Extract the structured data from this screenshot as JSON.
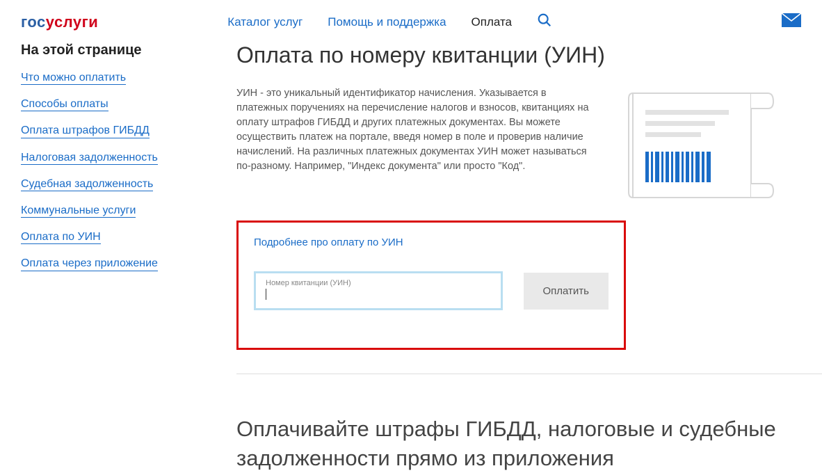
{
  "logo": {
    "part1": "гос",
    "part2": "услуги"
  },
  "nav": {
    "catalog": "Каталог услуг",
    "help": "Помощь и поддержка",
    "payment": "Оплата"
  },
  "sidebar": {
    "title": "На этой странице",
    "items": [
      "Что можно оплатить",
      "Способы оплаты",
      "Оплата штрафов ГИБДД",
      "Налоговая задолженность",
      "Судебная задолженность",
      "Коммунальные услуги",
      "Оплата по УИН",
      "Оплата через приложение"
    ]
  },
  "main": {
    "title": "Оплата по номеру квитанции (УИН)",
    "desc": "УИН - это уникальный идентификатор начисления. Указывается в платежных поручениях на перечисление налогов и взносов, квитанциях на оплату штрафов ГИБДД и других платежных документах. Вы можете осуществить платеж на портале, введя номер в поле и проверив наличие начислений. На различных платежных документах УИН может называться по-разному. Например, \"Индекс документа\" или просто \"Код\".",
    "more_link": "Подробнее про оплату по УИН",
    "input_label": "Номер квитанции (УИН)",
    "input_value": "",
    "pay_button": "Оплатить",
    "section2": "Оплачивайте штрафы ГИБДД, налоговые и судебные задолженности прямо из приложения"
  }
}
